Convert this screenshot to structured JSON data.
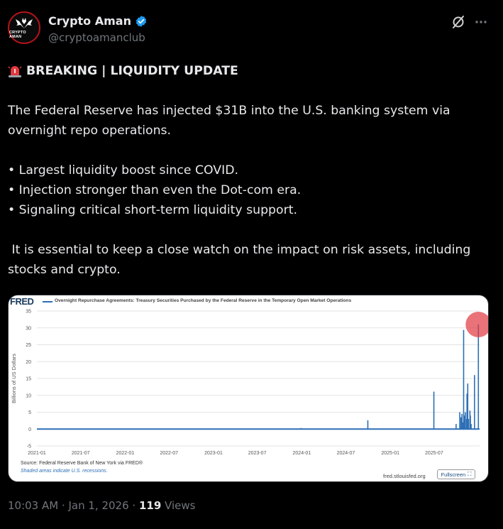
{
  "author": {
    "display_name": "Crypto Aman",
    "handle": "@cryptoamanclub",
    "avatar_text": "CRYPTO AMAN",
    "verified": true
  },
  "tweet": {
    "headline": "BREAKING | LIQUIDITY UPDATE",
    "paragraph1": "The Federal Reserve has injected $31B into the U.S. banking system via overnight repo operations.",
    "bullets": [
      "• Largest liquidity boost since COVID.",
      "• Injection stronger than even the Dot-com era.",
      "• Signaling critical short-term liquidity support."
    ],
    "paragraph2": " It is essential to keep a close watch on the impact on risk assets, including stocks and crypto."
  },
  "media": {
    "logo": "FRED",
    "source": "Source: Federal Reserve Bank of New York via FRED®",
    "shaded_note": "Shaded areas indicate U.S. recessions.",
    "site": "fred.stlouisfed.org",
    "fullscreen_label": "Fullscreen"
  },
  "meta": {
    "time": "10:03 AM · Jan 1, 2026 · ",
    "views_count": "119",
    "views_label": " Views"
  },
  "colors": {
    "background": "#000000",
    "text": "#e7e9ea",
    "muted": "#71767b",
    "series": "#2c6eb5",
    "highlight": "#e0383e",
    "verified": "#1d9bf0"
  },
  "chart_data": {
    "type": "bar",
    "title": "Overnight Repurchase Agreements: Treasury Securities Purchased by the Federal Reserve in the Temporary Open Market Operations",
    "ylabel": "Billions of US Dollars",
    "xlabel": "",
    "ylim": [
      -5,
      35
    ],
    "yticks": [
      -5,
      0,
      5,
      10,
      15,
      20,
      25,
      30,
      35
    ],
    "xticks": [
      "2021-01",
      "2021-07",
      "2022-01",
      "2022-07",
      "2023-01",
      "2023-07",
      "2024-01",
      "2024-07",
      "2025-01",
      "2025-07"
    ],
    "grid": true,
    "legend": "top",
    "series": [
      {
        "name": "Overnight Repurchase Agreements: Treasury Securities Purchased by the Federal Reserve in the Temporary Open Market Operations",
        "points": [
          [
            "2023-12-29",
            0.3
          ],
          [
            "2024-09-30",
            2.6
          ],
          [
            "2025-06-30",
            11.1
          ],
          [
            "2025-09-30",
            1.5
          ],
          [
            "2025-10-15",
            5.0
          ],
          [
            "2025-10-20",
            3.5
          ],
          [
            "2025-10-24",
            4.5
          ],
          [
            "2025-10-28",
            2.0
          ],
          [
            "2025-10-31",
            29.4
          ],
          [
            "2025-11-03",
            4.0
          ],
          [
            "2025-11-07",
            5.0
          ],
          [
            "2025-11-12",
            3.0
          ],
          [
            "2025-11-14",
            10.5
          ],
          [
            "2025-11-17",
            13.5
          ],
          [
            "2025-11-20",
            3.0
          ],
          [
            "2025-11-26",
            5.5
          ],
          [
            "2025-11-28",
            4.0
          ],
          [
            "2025-12-01",
            1.5
          ],
          [
            "2025-12-15",
            16.0
          ],
          [
            "2025-12-31",
            31.0
          ]
        ]
      }
    ],
    "highlight": [
      "2025-12-31",
      31.0
    ]
  }
}
